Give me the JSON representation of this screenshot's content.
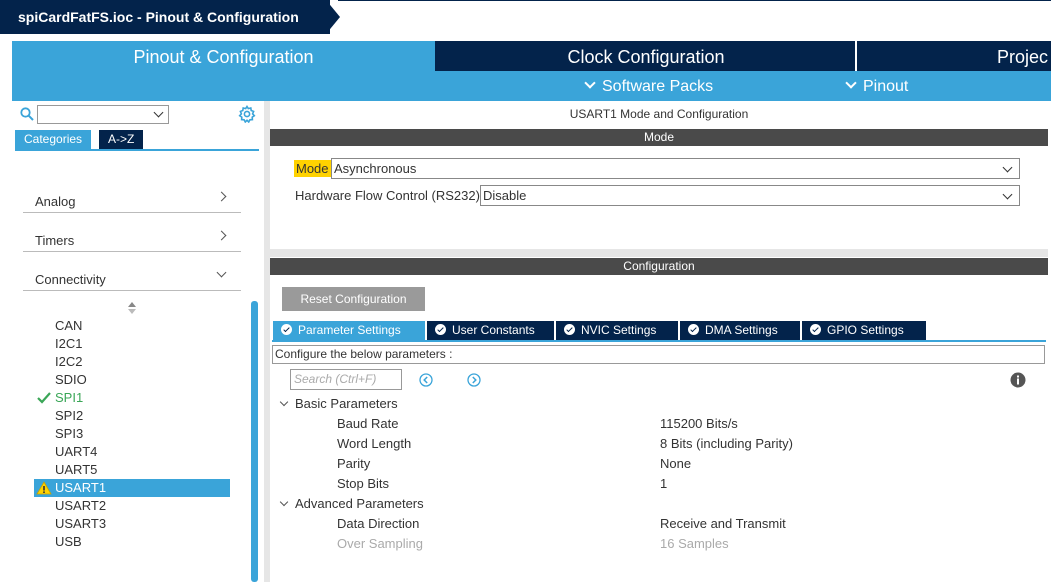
{
  "titlebar": {
    "title": "spiCardFatFS.ioc - Pinout & Configuration"
  },
  "main_tabs": [
    {
      "label": "Pinout & Configuration"
    },
    {
      "label": "Clock Configuration"
    },
    {
      "label": "Projec"
    }
  ],
  "sub_menu": [
    {
      "label": "Software Packs"
    },
    {
      "label": "Pinout"
    }
  ],
  "left": {
    "search_value": "",
    "tabs": [
      {
        "label": "Categories"
      },
      {
        "label": "A->Z"
      }
    ],
    "categories": [
      {
        "label": "Analog"
      },
      {
        "label": "Timers"
      },
      {
        "label": "Connectivity"
      }
    ],
    "peripherals": [
      {
        "label": "CAN",
        "status": "none"
      },
      {
        "label": "I2C1",
        "status": "none"
      },
      {
        "label": "I2C2",
        "status": "none"
      },
      {
        "label": "SDIO",
        "status": "none"
      },
      {
        "label": "SPI1",
        "status": "ok"
      },
      {
        "label": "SPI2",
        "status": "none"
      },
      {
        "label": "SPI3",
        "status": "none"
      },
      {
        "label": "UART4",
        "status": "none"
      },
      {
        "label": "UART5",
        "status": "none"
      },
      {
        "label": "USART1",
        "status": "warning"
      },
      {
        "label": "USART2",
        "status": "none"
      },
      {
        "label": "USART3",
        "status": "none"
      },
      {
        "label": "USB",
        "status": "none"
      }
    ]
  },
  "right": {
    "title": "USART1 Mode and Configuration",
    "mode_band": "Mode",
    "mode_label": "Mode",
    "mode_value": "Asynchronous",
    "flow_label": "Hardware Flow Control (RS232)",
    "flow_value": "Disable",
    "config_band": "Configuration",
    "reset_button": "Reset Configuration",
    "param_tabs": [
      {
        "label": "Parameter Settings"
      },
      {
        "label": "User Constants"
      },
      {
        "label": "NVIC Settings"
      },
      {
        "label": "DMA Settings"
      },
      {
        "label": "GPIO Settings"
      }
    ],
    "configure_text": "Configure the below parameters :",
    "search_placeholder": "Search (Ctrl+F)",
    "groups": [
      {
        "label": "Basic Parameters",
        "params": [
          {
            "name": "Baud Rate",
            "value": "115200 Bits/s"
          },
          {
            "name": "Word Length",
            "value": "8 Bits (including Parity)"
          },
          {
            "name": "Parity",
            "value": "None"
          },
          {
            "name": "Stop Bits",
            "value": "1"
          }
        ]
      },
      {
        "label": "Advanced Parameters",
        "params": [
          {
            "name": "Data Direction",
            "value": "Receive and Transmit"
          },
          {
            "name": "Over Sampling",
            "value": "16 Samples"
          }
        ]
      }
    ]
  },
  "colors": {
    "navy": "#03234b",
    "accent": "#3aa4d9",
    "ok": "#3aa657",
    "warning": "#ffd200"
  }
}
